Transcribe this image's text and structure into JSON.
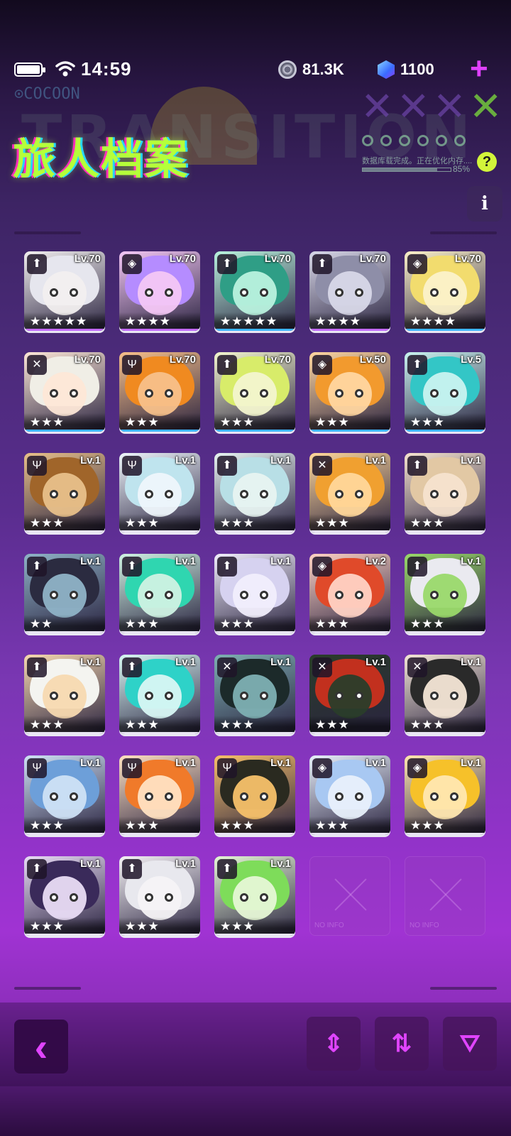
{
  "status": {
    "time": "14:59"
  },
  "currency": {
    "coins": "81.3K",
    "gems": "1100"
  },
  "banner": {
    "cocoon": "COCOON",
    "ghost_word": "TRANSITION",
    "title": "旅人档案",
    "progress_text": "数据库载完成。正在优化内存....",
    "progress_pct": "85%",
    "progress_value": 0.85,
    "help": "?"
  },
  "info_button": "i",
  "colors": {
    "accent": "#e040ff",
    "title": "#b5ff3a"
  },
  "cards": [
    {
      "lv": "Lv.70",
      "cls": "⬆",
      "stars": "★★★★★",
      "hair": "#e6e6ee",
      "face": "#f2efef",
      "edge": "#c36bff"
    },
    {
      "lv": "Lv.70",
      "cls": "◈",
      "stars": "★★★★",
      "hair": "#b58cff",
      "face": "#f4c7f5",
      "edge": "#c36bff"
    },
    {
      "lv": "Lv.70",
      "cls": "⬆",
      "stars": "★★★★★",
      "hair": "#2f9e86",
      "face": "#b9f2de",
      "edge": "#3fb6ff"
    },
    {
      "lv": "Lv.70",
      "cls": "⬆",
      "stars": "★★★★",
      "hair": "#8e8ea8",
      "face": "#d8d8e8",
      "edge": "#c36bff"
    },
    {
      "lv": "Lv.70",
      "cls": "◈",
      "stars": "★★★★",
      "hair": "#f2dc6e",
      "face": "#fbf1c9",
      "edge": "#3fb6ff"
    },
    {
      "lv": "Lv.70",
      "cls": "✕",
      "stars": "★★★",
      "hair": "#f0eee6",
      "face": "#fde7d7",
      "edge": "#3fb6ff"
    },
    {
      "lv": "Lv.70",
      "cls": "Ψ",
      "stars": "★★★",
      "hair": "#f08a20",
      "face": "#f7c08a",
      "edge": "#3fb6ff"
    },
    {
      "lv": "Lv.70",
      "cls": "⬆",
      "stars": "★★★",
      "hair": "#d8ec6a",
      "face": "#f3f6cf",
      "edge": "#3fb6ff"
    },
    {
      "lv": "Lv.50",
      "cls": "◈",
      "stars": "★★★",
      "hair": "#f29a2e",
      "face": "#ffd6a0",
      "edge": "#3fb6ff"
    },
    {
      "lv": "Lv.5",
      "cls": "⬆",
      "stars": "★★★",
      "hair": "#33c6c6",
      "face": "#c9f3f0",
      "edge": "#3fb6ff"
    },
    {
      "lv": "Lv.1",
      "cls": "Ψ",
      "stars": "★★★",
      "hair": "#a0652a",
      "face": "#e8c08a",
      "edge": "#e9e6f3"
    },
    {
      "lv": "Lv.1",
      "cls": "Ψ",
      "stars": "★★★",
      "hair": "#bfe4ee",
      "face": "#eef5fb",
      "edge": "#e9e6f3"
    },
    {
      "lv": "Lv.1",
      "cls": "⬆",
      "stars": "★★★",
      "hair": "#b8dfe6",
      "face": "#e7f3f1",
      "edge": "#e9e6f3"
    },
    {
      "lv": "Lv.1",
      "cls": "✕",
      "stars": "★★★",
      "hair": "#f0a030",
      "face": "#ffd79a",
      "edge": "#e9e6f3"
    },
    {
      "lv": "Lv.1",
      "cls": "⬆",
      "stars": "★★★",
      "hair": "#e2c8a4",
      "face": "#f6e3cf",
      "edge": "#e9e6f3"
    },
    {
      "lv": "Lv.1",
      "cls": "⬆",
      "stars": "★★",
      "hair": "#2b2b40",
      "face": "#8fb3c7",
      "edge": "#e9e6f3"
    },
    {
      "lv": "Lv.1",
      "cls": "⬆",
      "stars": "★★★",
      "hair": "#2fd6b0",
      "face": "#cff2e3",
      "edge": "#e9e6f3"
    },
    {
      "lv": "Lv.1",
      "cls": "⬆",
      "stars": "★★★",
      "hair": "#d6d2f0",
      "face": "#f1eefc",
      "edge": "#e9e6f3"
    },
    {
      "lv": "Lv.2",
      "cls": "◈",
      "stars": "★★★",
      "hair": "#e04a2a",
      "face": "#ffd2c4",
      "edge": "#e9e6f3"
    },
    {
      "lv": "Lv.1",
      "cls": "⬆",
      "stars": "★★★",
      "hair": "#eaeaf0",
      "face": "#9ad96a",
      "edge": "#e9e6f3"
    },
    {
      "lv": "Lv.1",
      "cls": "⬆",
      "stars": "★★★",
      "hair": "#f4f4f0",
      "face": "#f7d9b0",
      "edge": "#e9e6f3"
    },
    {
      "lv": "Lv.1",
      "cls": "⬆",
      "stars": "★★★",
      "hair": "#2ed2c8",
      "face": "#d8f7f4",
      "edge": "#e9e6f3"
    },
    {
      "lv": "Lv.1",
      "cls": "✕",
      "stars": "★★★",
      "hair": "#1c2a2a",
      "face": "#7eb0b3",
      "edge": "#e9e6f3"
    },
    {
      "lv": "Lv.1",
      "cls": "✕",
      "stars": "★★★",
      "hair": "#c2301e",
      "face": "#2a3d2a",
      "edge": "#e9e6f3"
    },
    {
      "lv": "Lv.1",
      "cls": "✕",
      "stars": "★★★",
      "hair": "#2a2a2a",
      "face": "#f4e6d6",
      "edge": "#e9e6f3"
    },
    {
      "lv": "Lv.1",
      "cls": "Ψ",
      "stars": "★★★",
      "hair": "#6d9fd9",
      "face": "#cfe2f6",
      "edge": "#e9e6f3"
    },
    {
      "lv": "Lv.1",
      "cls": "Ψ",
      "stars": "★★★",
      "hair": "#f07a2a",
      "face": "#ffe1c2",
      "edge": "#e9e6f3"
    },
    {
      "lv": "Lv.1",
      "cls": "Ψ",
      "stars": "★★★",
      "hair": "#2a2a20",
      "face": "#f7c16a",
      "edge": "#e9e6f3"
    },
    {
      "lv": "Lv.1",
      "cls": "◈",
      "stars": "★★★",
      "hair": "#a8c8f2",
      "face": "#e8f0fb",
      "edge": "#e9e6f3"
    },
    {
      "lv": "Lv.1",
      "cls": "◈",
      "stars": "★★★",
      "hair": "#f6c12a",
      "face": "#ffe7b0",
      "edge": "#e9e6f3"
    },
    {
      "lv": "Lv.1",
      "cls": "⬆",
      "stars": "★★★",
      "hair": "#3a2a5a",
      "face": "#e9dcf6",
      "edge": "#e9e6f3"
    },
    {
      "lv": "Lv.1",
      "cls": "⬆",
      "stars": "★★★",
      "hair": "#e8e8ee",
      "face": "#f6f3f6",
      "edge": "#e9e6f3"
    },
    {
      "lv": "Lv.1",
      "cls": "⬆",
      "stars": "★★★",
      "hair": "#7edc5a",
      "face": "#e6f7d6",
      "edge": "#e9e6f3"
    }
  ],
  "empty_slots": [
    {
      "label": "NO INFO"
    },
    {
      "label": "NO INFO"
    }
  ],
  "bottom_bar": {
    "back": "‹",
    "sort_order": "⇕",
    "sort_swap": "⇅",
    "filter": "⛛"
  }
}
